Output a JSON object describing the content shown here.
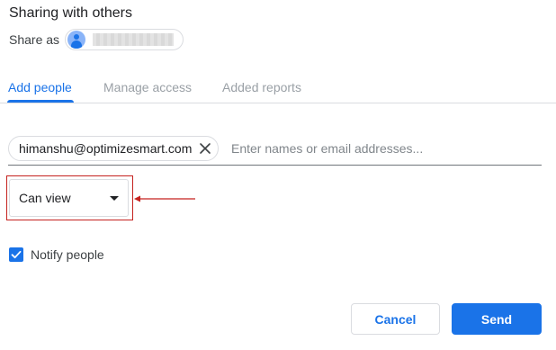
{
  "dialog": {
    "title": "Sharing with others"
  },
  "share_as": {
    "label": "Share as",
    "avatar_icon": "account-circle-icon"
  },
  "tabs": [
    {
      "label": "Add people",
      "active": true
    },
    {
      "label": "Manage access",
      "active": false
    },
    {
      "label": "Added reports",
      "active": false
    }
  ],
  "recipients": {
    "chips": [
      {
        "email": "himanshu@optimizesmart.com",
        "remove_icon": "close-icon"
      }
    ],
    "input_value": "",
    "placeholder": "Enter names or email addresses..."
  },
  "permission": {
    "selected": "Can view",
    "caret_icon": "dropdown-caret-icon",
    "annotation_icon": "red-arrow-icon"
  },
  "notify": {
    "label": "Notify people",
    "checked": true
  },
  "buttons": {
    "cancel": "Cancel",
    "send": "Send"
  },
  "colors": {
    "accent": "#1a73e8",
    "annotation": "#c5221f",
    "inactive_tab": "#9aa0a6"
  }
}
